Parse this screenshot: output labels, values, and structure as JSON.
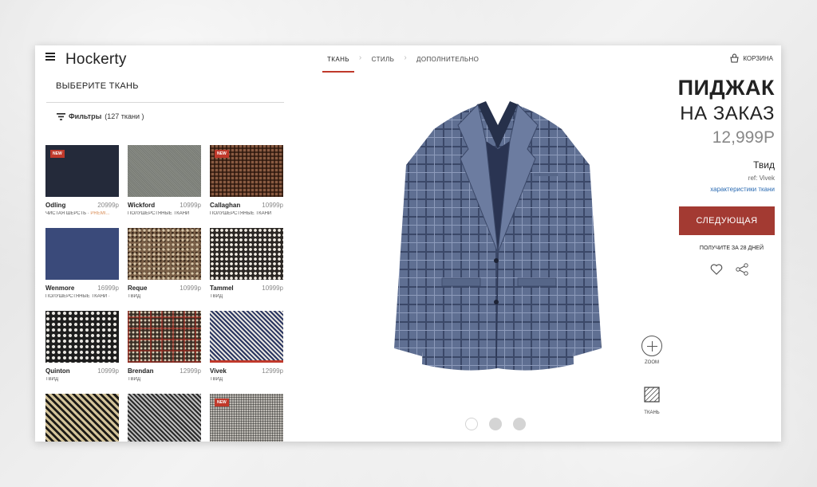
{
  "header": {
    "logo": "Hockerty",
    "steps": [
      "ТКАНЬ",
      "СТИЛЬ",
      "ДОПОЛНИТЕЛЬНО"
    ],
    "active_step": 0,
    "cart_label": "КОРЗИНА"
  },
  "left": {
    "title": "ВЫБЕРИТЕ ТКАНЬ",
    "filters_label": "Фильтры",
    "filters_count": "(127 ткани )",
    "fabrics": [
      {
        "name": "Odling",
        "price": "20999р",
        "sub": "ЧИСТАЯ ШЕРСТЬ · ",
        "premium": "PREMI...",
        "badge": "NEW",
        "pattern": "navy"
      },
      {
        "name": "Wickford",
        "price": "10999р",
        "sub": "ПОЛУШЕРСТЯНЫЕ ТКАНИ",
        "premium": "",
        "badge": "",
        "pattern": "grey"
      },
      {
        "name": "Callaghan",
        "price": "10999р",
        "sub": "ПОЛУШЕРСТЯНЫЕ ТКАНИ",
        "premium": "",
        "badge": "NEW",
        "pattern": "brown-check"
      },
      {
        "name": "Wenmore",
        "price": "16999р",
        "sub": "ПОЛУШЕРСТЯНЫЕ ТКАНИ ·",
        "premium": "",
        "badge": "",
        "pattern": "blue"
      },
      {
        "name": "Reque",
        "price": "10999р",
        "sub": "ТВИД",
        "premium": "",
        "badge": "",
        "pattern": "tweed-brown"
      },
      {
        "name": "Tammel",
        "price": "10999р",
        "sub": "ТВИД",
        "premium": "",
        "badge": "",
        "pattern": "tweed-bw"
      },
      {
        "name": "Quinton",
        "price": "10999р",
        "sub": "ТВИД",
        "premium": "",
        "badge": "",
        "pattern": "tweed-bw2"
      },
      {
        "name": "Brendan",
        "price": "12999р",
        "sub": "ТВИД",
        "premium": "",
        "badge": "",
        "pattern": "plaid-multi"
      },
      {
        "name": "Vivek",
        "price": "12999р",
        "sub": "ТВИД",
        "premium": "",
        "badge": "",
        "pattern": "hounds-blue"
      },
      {
        "name": "",
        "price": "",
        "sub": "",
        "premium": "",
        "badge": "",
        "pattern": "hounds-gold"
      },
      {
        "name": "",
        "price": "",
        "sub": "",
        "premium": "",
        "badge": "",
        "pattern": "hounds-grey"
      },
      {
        "name": "",
        "price": "",
        "sub": "",
        "premium": "",
        "badge": "NEW",
        "pattern": "glen"
      }
    ]
  },
  "product": {
    "title_line1": "ПИДЖАК",
    "title_line2": "НА ЗАКАЗ",
    "price": "12,999Р",
    "fabric_name": "Твид",
    "fabric_ref": "ref: Vivek",
    "fabric_link": "характеристики ткани",
    "next_label": "СЛЕДУЮЩАЯ",
    "delivery": "ПОЛУЧИТЕ ЗА 28 ДНЕЙ"
  },
  "tools": {
    "zoom_label": "ZOOM",
    "fabric_label": "ТКАНЬ"
  },
  "carousel": {
    "count": 3,
    "active": 0
  },
  "colors": {
    "accent": "#c0392b",
    "button": "#a33a32",
    "link": "#2b6bb2"
  }
}
